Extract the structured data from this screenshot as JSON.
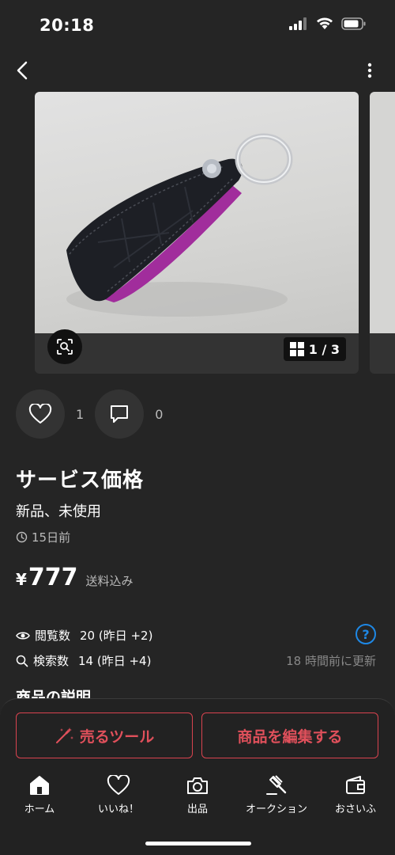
{
  "status_bar": {
    "time": "20:18"
  },
  "product": {
    "image_counter": "1 / 3",
    "likes": "1",
    "comments": "0",
    "title": "サービス価格",
    "condition": "新品、未使用",
    "posted": "15日前",
    "price_symbol": "¥",
    "price": "777",
    "shipping_note": "送料込み"
  },
  "stats": {
    "views_label": "閲覧数",
    "views_value": "20 (昨日 +2)",
    "searches_label": "検索数",
    "searches_value": "14 (昨日 +4)",
    "updated": "18 時間前に更新"
  },
  "description_heading": "商品の説明",
  "actions": {
    "sell_tool": "売るツール",
    "edit": "商品を編集する"
  },
  "tabs": [
    {
      "label": "ホーム",
      "icon": "home-icon"
    },
    {
      "label": "いいね！",
      "icon": "heart-icon"
    },
    {
      "label": "出品",
      "icon": "camera-icon"
    },
    {
      "label": "オークション",
      "icon": "gavel-icon"
    },
    {
      "label": "おさいふ",
      "icon": "wallet-icon"
    }
  ],
  "colors": {
    "accent": "#e0505b",
    "help": "#1e88e5",
    "background": "#252525"
  }
}
